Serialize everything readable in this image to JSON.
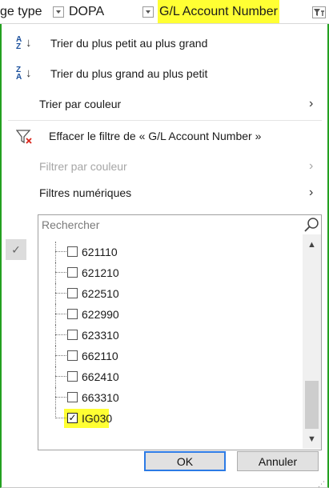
{
  "header": {
    "col1": "ge type",
    "col2": "DOPA",
    "col3": "G/L Account Number"
  },
  "menu": {
    "sort_asc": "Trier du plus petit au plus grand",
    "sort_desc": "Trier du plus grand au plus petit",
    "sort_color": "Trier par couleur",
    "clear_filter": "Effacer le filtre de « G/L Account Number »",
    "filter_color": "Filtrer par couleur",
    "numeric_filters": "Filtres numériques"
  },
  "search": {
    "placeholder": "Rechercher"
  },
  "list": {
    "items": [
      {
        "label": "621110",
        "checked": false
      },
      {
        "label": "621210",
        "checked": false
      },
      {
        "label": "622510",
        "checked": false
      },
      {
        "label": "622990",
        "checked": false
      },
      {
        "label": "623310",
        "checked": false
      },
      {
        "label": "662110",
        "checked": false
      },
      {
        "label": "662410",
        "checked": false
      },
      {
        "label": "663310",
        "checked": false
      },
      {
        "label": "IG030",
        "checked": true
      }
    ]
  },
  "buttons": {
    "ok": "OK",
    "cancel": "Annuler"
  },
  "colors": {
    "highlight": "#ffff33",
    "border_green": "#23a020",
    "accent": "#2c7be5"
  }
}
